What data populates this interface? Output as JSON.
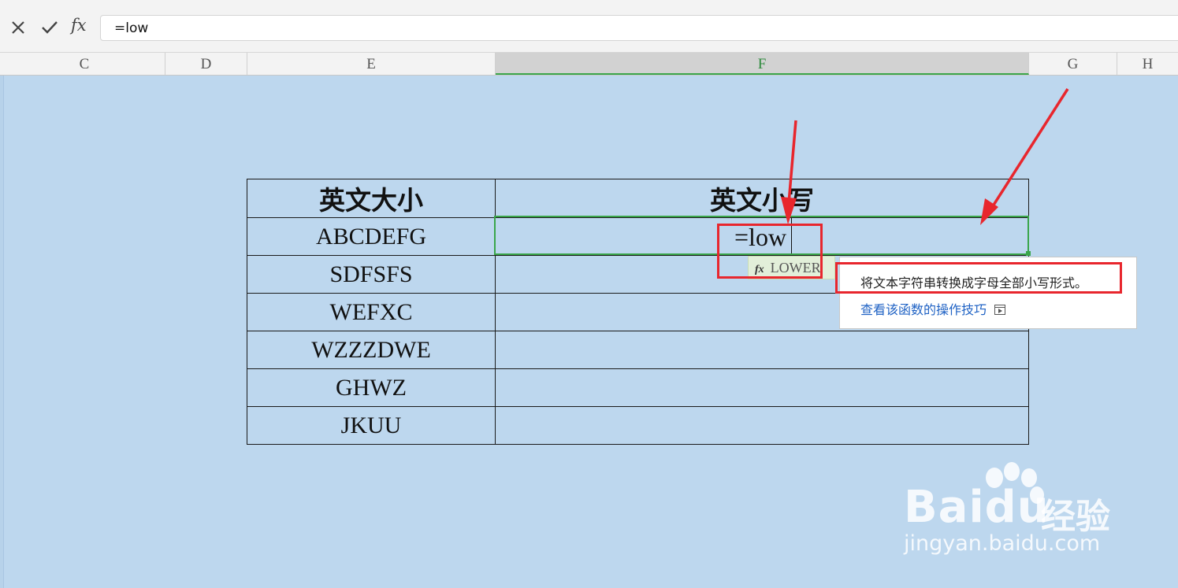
{
  "formula_bar": {
    "cancel_icon": "x-icon",
    "confirm_icon": "check-icon",
    "fx_label": "fx",
    "formula_value": "=low"
  },
  "columns": [
    {
      "label": "C",
      "active": false
    },
    {
      "label": "D",
      "active": false
    },
    {
      "label": "E",
      "active": false
    },
    {
      "label": "F",
      "active": true
    },
    {
      "label": "G",
      "active": false
    },
    {
      "label": "H",
      "active": false
    }
  ],
  "table": {
    "headers": [
      "英文大小",
      "英文小写"
    ],
    "rows": [
      {
        "upper": "ABCDEFG",
        "lower": "=low"
      },
      {
        "upper": "SDFSFS",
        "lower": ""
      },
      {
        "upper": "WEFXC",
        "lower": ""
      },
      {
        "upper": "WZZZDWE",
        "lower": ""
      },
      {
        "upper": "GHWZ",
        "lower": ""
      },
      {
        "upper": "JKUU",
        "lower": ""
      }
    ]
  },
  "autocomplete": {
    "fx_glyph": "fx",
    "function_name": "LOWER"
  },
  "tooltip": {
    "description": "将文本字符串转换成字母全部小写形式。",
    "link_text": "查看该函数的操作技巧"
  },
  "annotation_color": "#e8262d",
  "watermark": {
    "brand": "Bai",
    "brand_suffix": "du",
    "brand_cn": "经验",
    "url": "jingyan.baidu.com"
  }
}
